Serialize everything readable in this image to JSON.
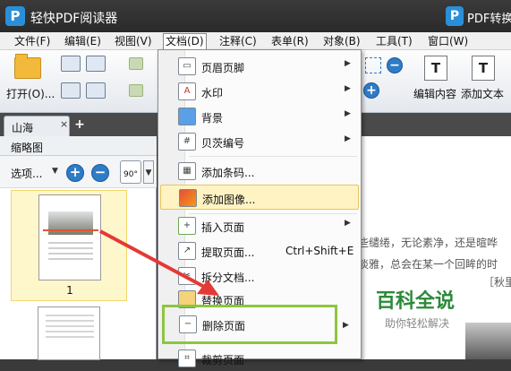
{
  "app": {
    "logo": "P",
    "title": "轻快PDF阅读器",
    "promo_logo": "P",
    "promo_text": "PDF转换"
  },
  "menubar": [
    "文件(F)",
    "编辑(E)",
    "视图(V)",
    "文档(D)",
    "注释(C)",
    "表单(R)",
    "对象(B)",
    "工具(T)",
    "窗口(W)"
  ],
  "toolbar": {
    "open_label": "打开(O)...",
    "edit_content_label": "编辑内容",
    "add_text_label": "添加文本",
    "edit_icon": "T",
    "add_text_icon": "T"
  },
  "tabs": {
    "doc_tab_label": "山海",
    "close": "×",
    "new_tab": "+"
  },
  "thumbnails": {
    "title": "缩略图",
    "options_label": "选项...",
    "zoom_in": "+",
    "zoom_out": "−",
    "rotate": "90°",
    "page_number": "1"
  },
  "document": {
    "line1": "些缱绻，无论素净，还是暄哗",
    "line2": "淡雅，总会在某一个回眸的时",
    "line3_right": "［秋里"
  },
  "watermark": {
    "title": "百科全说",
    "subtitle": "助你轻松解决"
  },
  "dropdown": {
    "items": [
      {
        "label": "页眉页脚",
        "icon": "header-footer-icon",
        "submenu": true
      },
      {
        "label": "水印",
        "icon": "watermark-icon",
        "submenu": true
      },
      {
        "label": "背景",
        "icon": "background-icon",
        "submenu": true
      },
      {
        "label": "贝茨编号",
        "icon": "bates-number-icon",
        "submenu": true
      },
      {
        "label": "添加条码...",
        "icon": "barcode-icon",
        "submenu": false
      },
      {
        "label": "添加图像...",
        "icon": "add-image-icon",
        "submenu": false
      },
      {
        "label": "插入页面",
        "icon": "insert-page-icon",
        "submenu": true
      },
      {
        "label": "提取页面...",
        "icon": "extract-page-icon",
        "submenu": false,
        "shortcut": "Ctrl+Shift+E"
      },
      {
        "label": "拆分文档...",
        "icon": "split-document-icon",
        "submenu": false
      },
      {
        "label": "替换页面",
        "icon": "replace-page-icon",
        "submenu": false
      },
      {
        "label": "删除页面",
        "icon": "delete-page-icon",
        "submenu": true
      },
      {
        "label": "裁剪页面",
        "icon": "crop-page-icon",
        "submenu": false
      }
    ]
  },
  "colors": {
    "highlight": "#fff3c4",
    "green_box": "#8cc63f",
    "red_arrow": "#e53935",
    "watermark_green": "#2a8a3a"
  }
}
